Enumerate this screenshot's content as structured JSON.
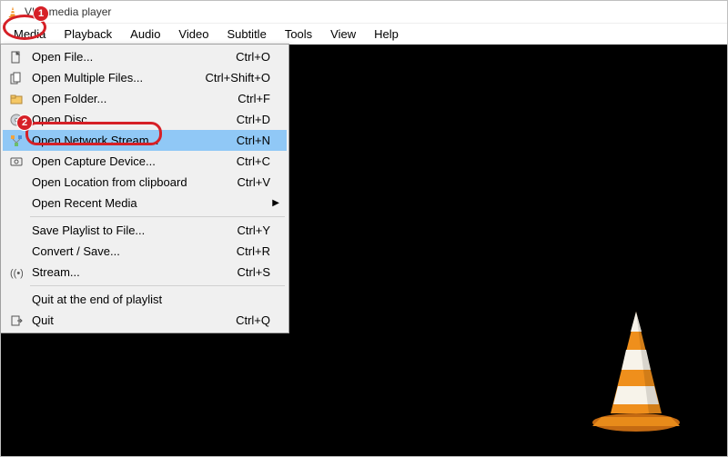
{
  "title": "VLC media player",
  "menubar": [
    "Media",
    "Playback",
    "Audio",
    "Video",
    "Subtitle",
    "Tools",
    "View",
    "Help"
  ],
  "active_menu_index": 0,
  "dropdown": {
    "groups": [
      [
        {
          "icon": "file-icon",
          "label": "Open File...",
          "shortcut": "Ctrl+O"
        },
        {
          "icon": "files-icon",
          "label": "Open Multiple Files...",
          "shortcut": "Ctrl+Shift+O"
        },
        {
          "icon": "folder-icon",
          "label": "Open Folder...",
          "shortcut": "Ctrl+F"
        },
        {
          "icon": "disc-icon",
          "label": "Open Disc...",
          "shortcut": "Ctrl+D"
        },
        {
          "icon": "network-icon",
          "label": "Open Network Stream...",
          "shortcut": "Ctrl+N",
          "highlight": true
        },
        {
          "icon": "capture-icon",
          "label": "Open Capture Device...",
          "shortcut": "Ctrl+C"
        },
        {
          "icon": "",
          "label": "Open Location from clipboard",
          "shortcut": "Ctrl+V"
        },
        {
          "icon": "",
          "label": "Open Recent Media",
          "shortcut": "",
          "submenu": true
        }
      ],
      [
        {
          "icon": "",
          "label": "Save Playlist to File...",
          "shortcut": "Ctrl+Y"
        },
        {
          "icon": "",
          "label": "Convert / Save...",
          "shortcut": "Ctrl+R"
        },
        {
          "icon": "stream-icon",
          "label": "Stream...",
          "shortcut": "Ctrl+S"
        }
      ],
      [
        {
          "icon": "",
          "label": "Quit at the end of playlist",
          "shortcut": ""
        },
        {
          "icon": "quit-icon",
          "label": "Quit",
          "shortcut": "Ctrl+Q"
        }
      ]
    ]
  },
  "annotations": {
    "badge1": "1",
    "badge2": "2"
  }
}
